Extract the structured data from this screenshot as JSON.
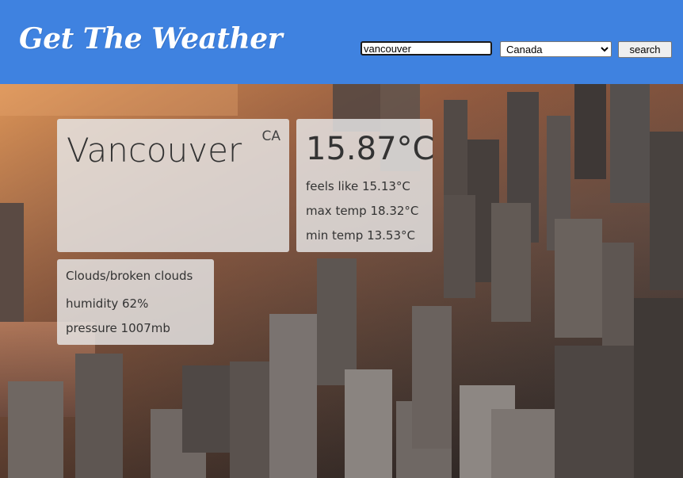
{
  "app": {
    "title": "Get The Weather"
  },
  "search": {
    "value": "vancouver",
    "country": "Canada",
    "button_label": "search"
  },
  "weather": {
    "city": "Vancouver",
    "country_code": "CA",
    "temp": "15.87°C",
    "feels_like": "feels like 15.13°C",
    "max_temp": "max temp 18.32°C",
    "min_temp": "min temp 13.53°C",
    "description": "Clouds/broken clouds",
    "humidity": "humidity 62%",
    "pressure": "pressure 1007mb"
  },
  "colors": {
    "header": "#3f82e0",
    "card": "#e8e8e8"
  }
}
